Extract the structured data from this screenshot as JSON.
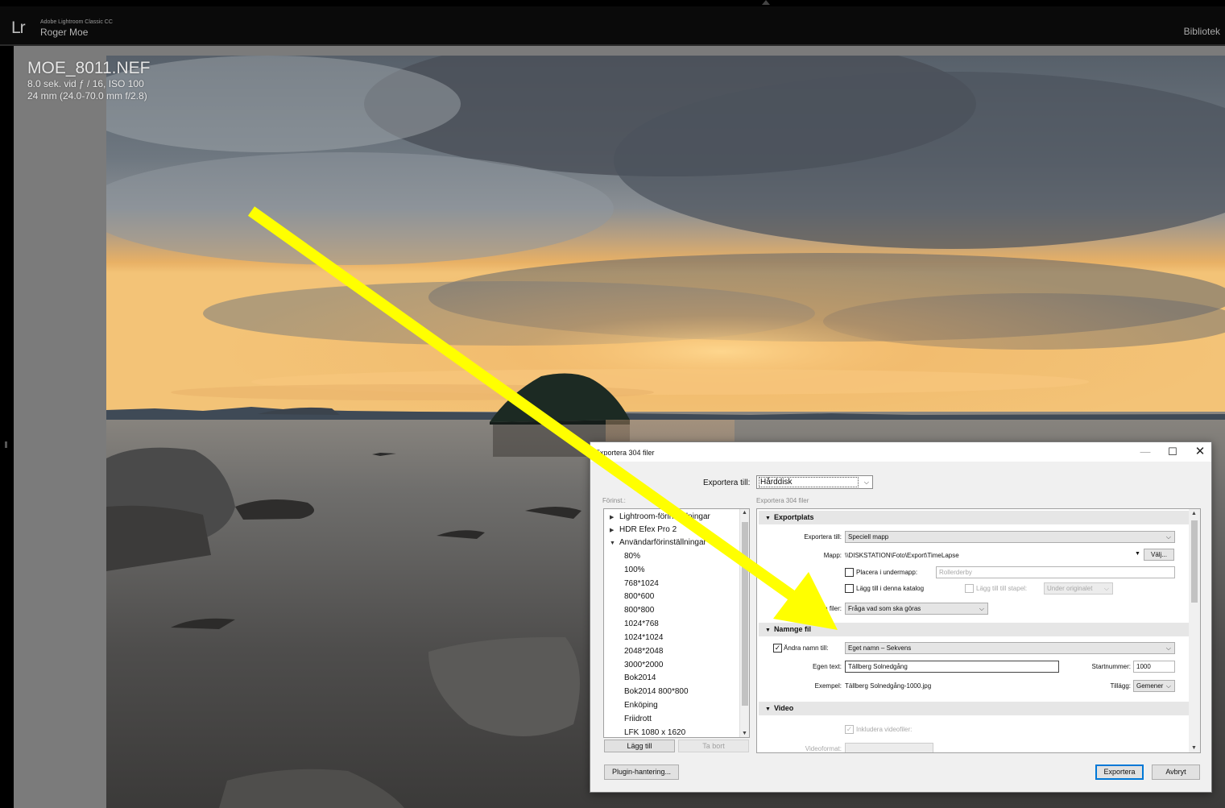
{
  "app": {
    "logo_text": "Lr",
    "product_name": "Adobe Lightroom Classic CC",
    "user_name": "Roger Moe",
    "module": "Bibliotek"
  },
  "photo_info": {
    "filename": "MOE_8011.NEF",
    "exposure": "8.0 sek. vid ƒ / 16, ISO 100",
    "lens": "24 mm (24.0-70.0 mm f/2.8)"
  },
  "colors": {
    "arrow": "#ffff00",
    "accent_button_border": "#0078d7"
  },
  "dialog": {
    "title": "Exportera 304 filer",
    "window_buttons": {
      "minimize": "—",
      "maximize": "☐",
      "close": "✕"
    },
    "export_to_label": "Exportera till:",
    "export_to_value": "Hårddisk",
    "preset_label": "Förinst.:",
    "export_count_label": "Exportera 304 filer",
    "presets": [
      {
        "label": "Lightroom-förinställningar",
        "kind": "collapsed-folder"
      },
      {
        "label": "HDR Efex Pro 2",
        "kind": "collapsed-folder"
      },
      {
        "label": "Användarförinställningar",
        "kind": "expanded-folder"
      },
      {
        "label": "80%",
        "kind": "preset"
      },
      {
        "label": "100%",
        "kind": "preset"
      },
      {
        "label": "768*1024",
        "kind": "preset"
      },
      {
        "label": "800*600",
        "kind": "preset"
      },
      {
        "label": "800*800",
        "kind": "preset"
      },
      {
        "label": "1024*768",
        "kind": "preset"
      },
      {
        "label": "1024*1024",
        "kind": "preset"
      },
      {
        "label": "2048*2048",
        "kind": "preset"
      },
      {
        "label": "3000*2000",
        "kind": "preset"
      },
      {
        "label": "Bok2014",
        "kind": "preset"
      },
      {
        "label": "Bok2014 800*800",
        "kind": "preset"
      },
      {
        "label": "Enköping",
        "kind": "preset"
      },
      {
        "label": "Friidrott",
        "kind": "preset"
      },
      {
        "label": "LFK 1080 x 1620",
        "kind": "preset"
      }
    ],
    "add_button": "Lägg till",
    "remove_button": "Ta bort",
    "sections": {
      "export_location": {
        "header": "Exportplats",
        "export_to_label": "Exportera till:",
        "export_to_value": "Speciell mapp",
        "folder_label": "Mapp:",
        "folder_value": "\\\\DISKSTATION\\Foto\\Export\\TimeLapse",
        "choose_button": "Välj...",
        "subfolder_checkbox": "Placera i undermapp:",
        "subfolder_value": "Rollerderby",
        "add_to_catalog": "Lägg till i denna katalog",
        "add_to_stack": "Lägg till till stapel:",
        "stack_value": "Under originalet",
        "existing_files_label": "Befintliga filer:",
        "existing_files_value": "Fråga vad som ska göras"
      },
      "file_naming": {
        "header": "Namnge fil",
        "rename_checkbox": "Ändra namn till:",
        "rename_checked": true,
        "rename_value": "Eget namn – Sekvens",
        "custom_text_label": "Egen text:",
        "custom_text_value": "Tällberg Solnedgång",
        "start_number_label": "Startnummer:",
        "start_number_value": "1000",
        "example_label": "Exempel:",
        "example_value": "Tällberg Solnedgång-1000.jpg",
        "extensions_label": "Tillägg:",
        "extensions_value": "Gemener"
      },
      "video": {
        "header": "Video",
        "include_video": "Inkludera videofiler:",
        "video_format_label": "Videoformat:"
      }
    },
    "plugin_button": "Plugin-hantering...",
    "export_button": "Exportera",
    "cancel_button": "Avbryt"
  }
}
